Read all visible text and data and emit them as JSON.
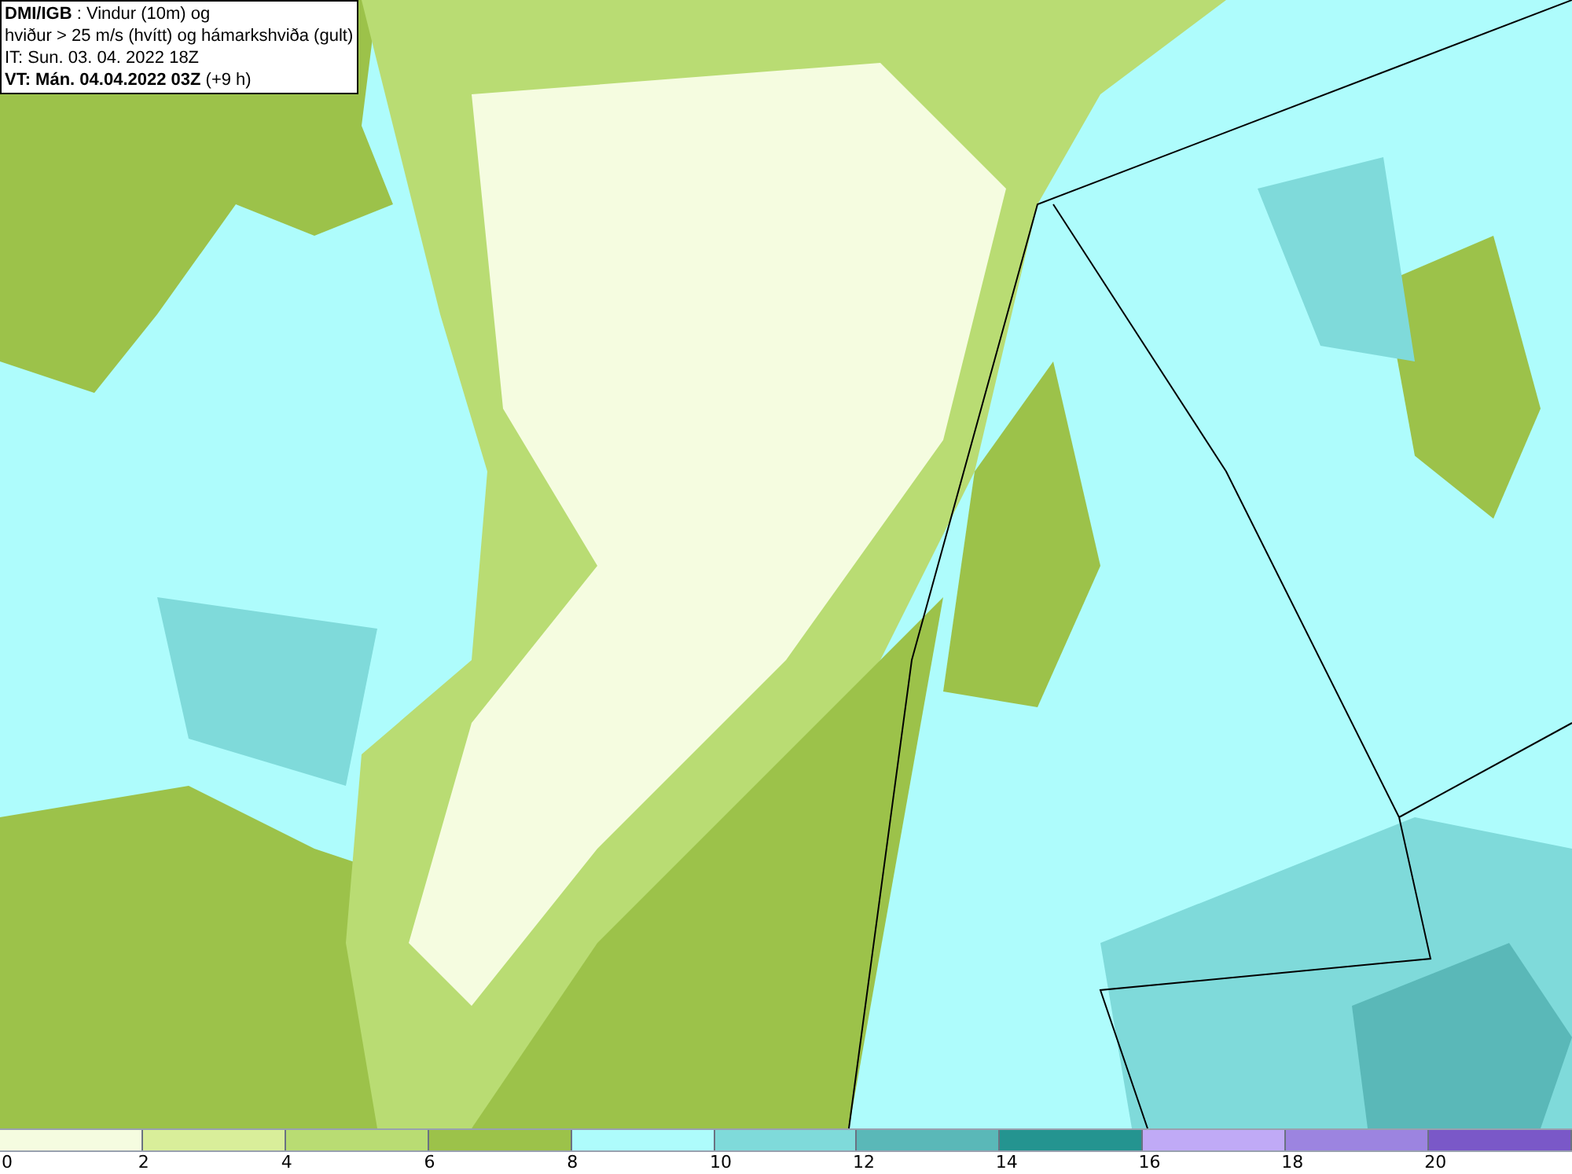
{
  "title_box": {
    "lines": [
      "**DMI/IGB** : Vindur (10m) og",
      "hviður > 25 m/s (hvítt) og hámarkshviða (gult)",
      "IT: Sun. 03. 04. 2022 18Z",
      "**VT: Mán. 04.04.2022 03Z** (+9 h)"
    ]
  },
  "colorbar": {
    "segments": [
      {
        "color": "#f5fce0"
      },
      {
        "color": "#d9ee9a"
      },
      {
        "color": "#b9dc73"
      },
      {
        "color": "#9cc24a"
      },
      {
        "color": "#aefcfc"
      },
      {
        "color": "#7fdada"
      },
      {
        "color": "#5ab8b8"
      },
      {
        "color": "#249490"
      },
      {
        "color": "#c0aaf6"
      },
      {
        "color": "#9c84e0"
      },
      {
        "color": "#7a58c8"
      }
    ],
    "labels": [
      "0",
      "2",
      "4",
      "6",
      "8",
      "10",
      "12",
      "14",
      "16",
      "18",
      "20"
    ]
  }
}
